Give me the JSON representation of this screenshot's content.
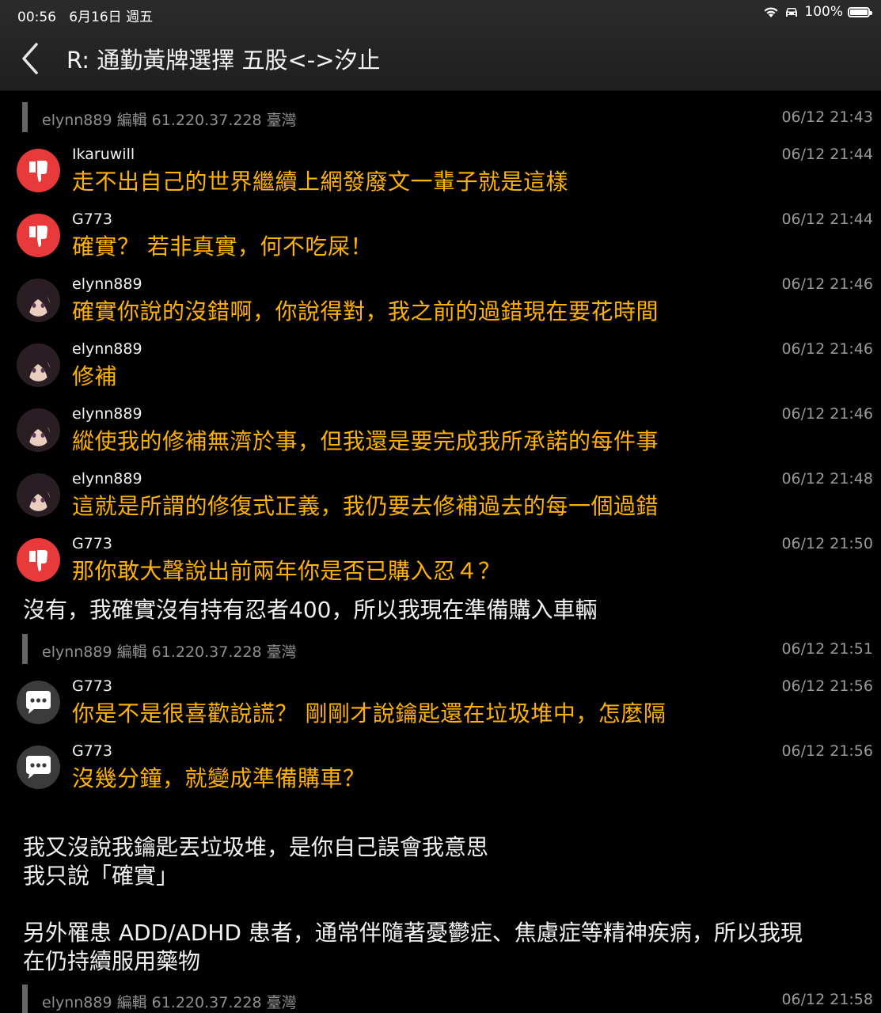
{
  "status_bar": {
    "time": "00:56",
    "date": "6月16日 週五",
    "battery": "100%"
  },
  "header": {
    "title": "R: 通勤黃牌選擇 五股<->汐止"
  },
  "edits": [
    {
      "meta": "elynn889 編輯  61.220.37.228 臺灣",
      "time": "06/12 21:43"
    },
    {
      "meta": "elynn889 編輯  61.220.37.228 臺灣",
      "time": "06/12 21:51"
    },
    {
      "meta": "elynn889 編輯  61.220.37.228 臺灣",
      "time": "06/12 21:58"
    }
  ],
  "comments": [
    {
      "type": "boo",
      "icon": "thumbs-down-icon",
      "user": "Ikaruwill",
      "time": "06/12 21:44",
      "text": "走不出自己的世界繼續上網發廢文一輩子就是這樣"
    },
    {
      "type": "boo",
      "icon": "thumbs-down-icon",
      "user": "G773",
      "time": "06/12 21:44",
      "text": "確實？ 若非真實，何不吃屎！"
    },
    {
      "type": "author",
      "icon": "avatar-photo",
      "user": "elynn889",
      "time": "06/12 21:46",
      "text": "確實你說的沒錯啊，你說得對，我之前的過錯現在要花時間"
    },
    {
      "type": "author",
      "icon": "avatar-photo",
      "user": "elynn889",
      "time": "06/12 21:46",
      "text": "修補"
    },
    {
      "type": "author",
      "icon": "avatar-photo",
      "user": "elynn889",
      "time": "06/12 21:46",
      "text": "縱使我的修補無濟於事，但我還是要完成我所承諾的每件事"
    },
    {
      "type": "author",
      "icon": "avatar-photo",
      "user": "elynn889",
      "time": "06/12 21:48",
      "text": "這就是所謂的修復式正義，我仍要去修補過去的每一個過錯"
    },
    {
      "type": "boo",
      "icon": "thumbs-down-icon",
      "user": "G773",
      "time": "06/12 21:50",
      "text": "那你敢大聲說出前兩年你是否已購入忍４？"
    },
    {
      "type": "neutral",
      "icon": "chat-bubble-icon",
      "user": "G773",
      "time": "06/12 21:56",
      "text": "你是不是很喜歡說謊？ 剛剛才說鑰匙還在垃圾堆中，怎麼隔"
    },
    {
      "type": "neutral",
      "icon": "chat-bubble-icon",
      "user": "G773",
      "time": "06/12 21:56",
      "text": "沒幾分鐘，就變成準備購車？"
    }
  ],
  "body": {
    "reply1": "沒有，我確實沒有持有忍者400，所以我現在準備購入車輛",
    "reply2_line1": "我又沒說我鑰匙丟垃圾堆，是你自己誤會我意思",
    "reply2_line2": "我只說「確實」",
    "reply3_line1": "另外罹患 ADD/ADHD 患者，通常伴隨著憂鬱症、焦慮症等精神疾病，所以我現",
    "reply3_line2": "在仍持續服用藥物"
  }
}
